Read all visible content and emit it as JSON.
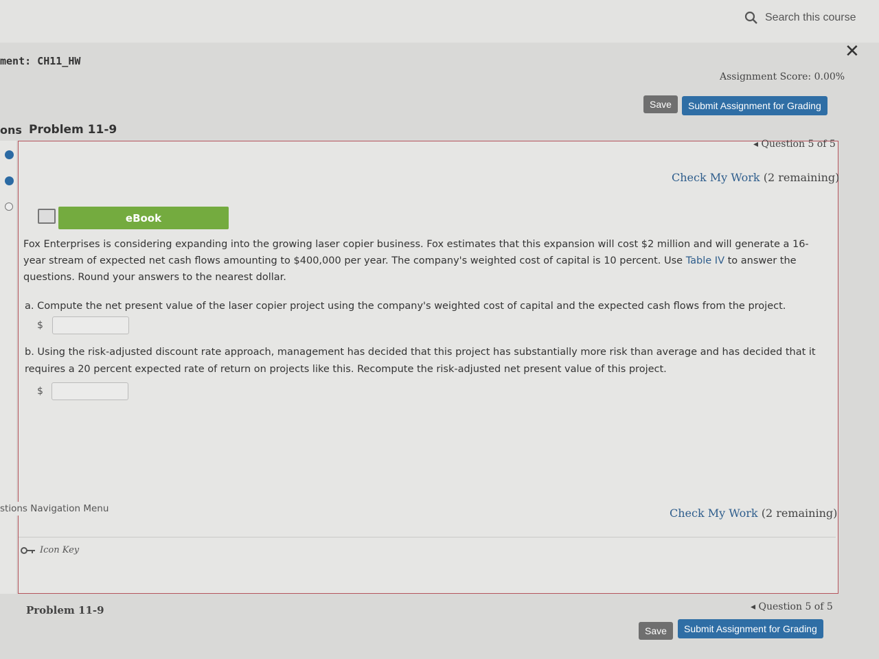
{
  "header": {
    "search_placeholder": "Search this course",
    "close_label": "✕",
    "assignment_title": "ment: CH11_HW",
    "assignment_score": "Assignment Score: 0.00%",
    "save_label": "Save",
    "submit_label": "Submit Assignment for Grading"
  },
  "tabs": {
    "left_fragment": "ons",
    "problem_title": "Problem 11-9"
  },
  "question_nav": {
    "top": "◂ Question 5 of 5",
    "bottom": "◂ Question 5 of 5"
  },
  "check_work": {
    "label": "Check My Work",
    "remaining": "(2 remaining)"
  },
  "ebook": {
    "label": "eBook"
  },
  "question": {
    "intro_before_link": "Fox Enterprises is considering expanding into the growing laser copier business. Fox estimates that this expansion will cost $2 million and will generate a 16-year stream of expected net cash flows amounting to $400,000 per year. The company's weighted cost of capital is 10 percent. Use ",
    "link": "Table IV",
    "intro_after_link": " to answer the questions. Round your answers to the nearest dollar.",
    "part_a": "a. Compute the net present value of the laser copier project using the company's weighted cost of capital and the expected cash flows from the project.",
    "part_b": "b. Using the risk-adjusted discount rate approach, management has decided that this project has substantially more risk than average and has decided that it requires a 20 percent expected rate of return on projects like this. Recompute the risk-adjusted net present value of this project.",
    "currency": "$"
  },
  "nav_menu": "stions Navigation Menu",
  "icon_key": "Icon Key",
  "footer": {
    "problem_title": "Problem 11-9",
    "save_label": "Save",
    "submit_label": "Submit Assignment for Grading"
  },
  "colors": {
    "accent": "#2f6ea5",
    "ebook": "#74ab3f",
    "border": "#b5535b"
  }
}
